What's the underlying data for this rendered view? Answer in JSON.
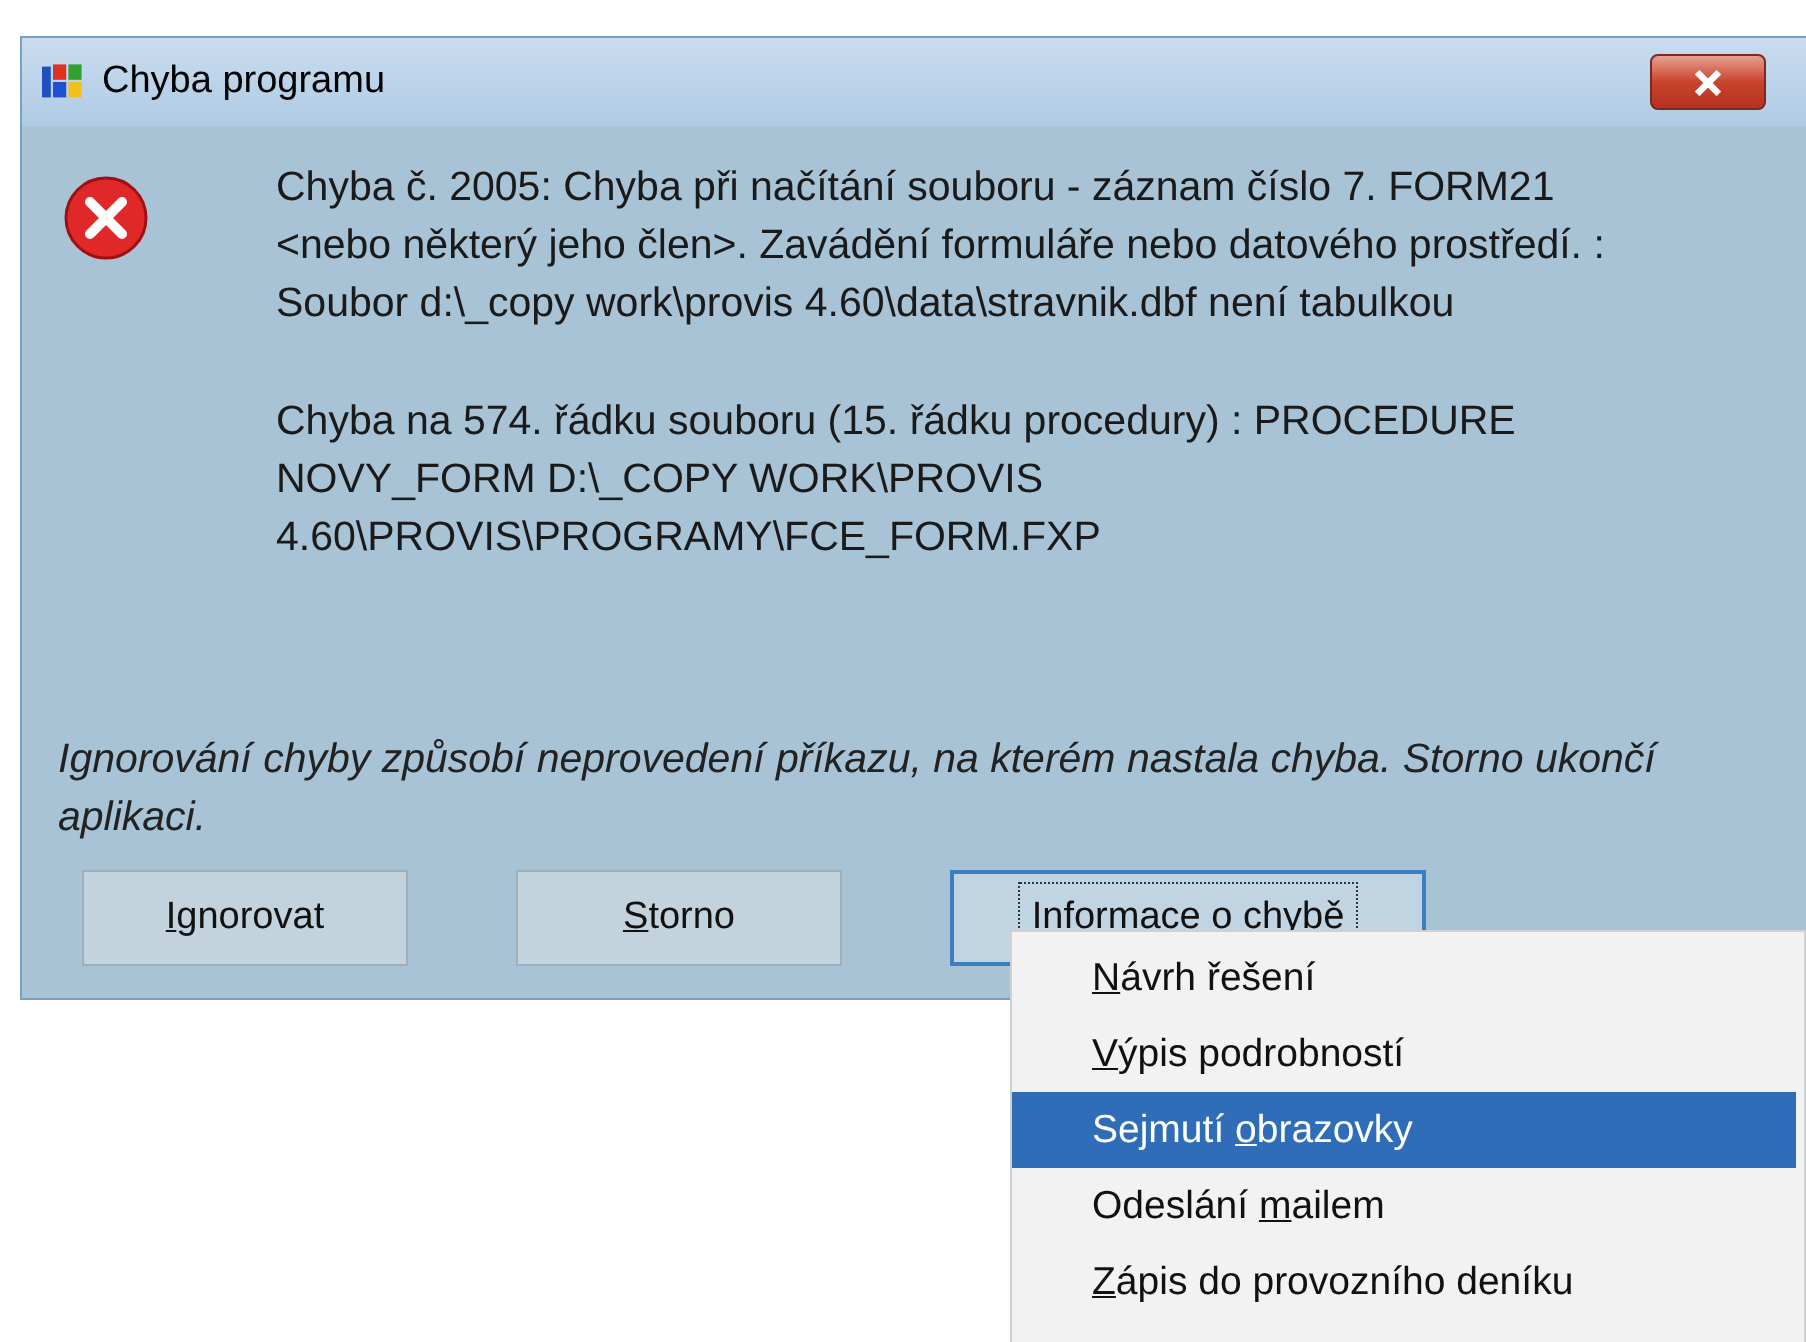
{
  "window": {
    "title": "Chyba programu"
  },
  "message": {
    "paragraphs": [
      "Chyba č. 2005: Chyba při načítání souboru - záznam číslo 7. FORM21 <nebo některý jeho člen>. Zavádění formuláře nebo datového prostředí. : Soubor d:\\_copy work\\provis 4.60\\data\\stravnik.dbf není tabulkou",
      "Chyba na 574. řádku souboru (15. řádku procedury) : PROCEDURE NOVY_FORM D:\\_COPY WORK\\PROVIS 4.60\\PROVIS\\PROGRAMY\\FCE_FORM.FXP"
    ],
    "note": "Ignorování chyby způsobí neprovedení příkazu, na kterém nastala chyba. Storno ukončí aplikaci."
  },
  "buttons": [
    {
      "key": "I",
      "post": "gnorovat",
      "focused": false
    },
    {
      "key": "S",
      "post": "torno",
      "focused": false
    },
    {
      "post": "Informace o chybě",
      "focused": true
    }
  ],
  "menu": [
    {
      "key": "N",
      "post": "ávrh řešení",
      "selected": false
    },
    {
      "key": "V",
      "post": "ýpis podrobností",
      "selected": false
    },
    {
      "pre": "Sejmutí ",
      "key": "o",
      "post": "brazovky",
      "selected": true
    },
    {
      "pre": "Odeslání ",
      "key": "m",
      "post": "ailem",
      "selected": false
    },
    {
      "key": "Z",
      "post": "ápis do provozního deníku",
      "selected": false
    }
  ]
}
